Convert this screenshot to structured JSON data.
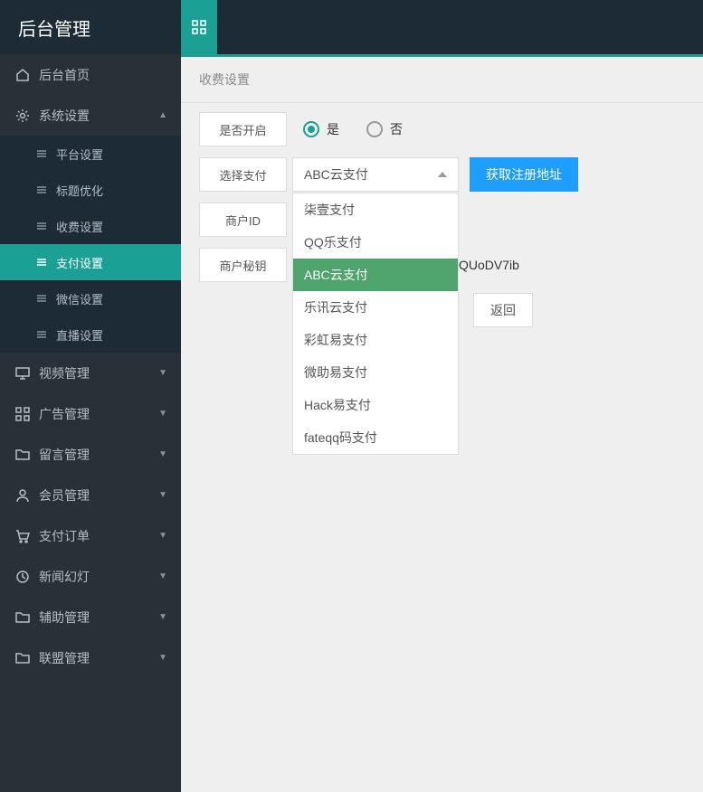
{
  "header": {
    "title": "后台管理"
  },
  "sidebar": {
    "items": [
      {
        "label": "后台首页",
        "icon": "home",
        "expandable": false
      },
      {
        "label": "系统设置",
        "icon": "gear",
        "expandable": true,
        "expanded": true,
        "children": [
          {
            "label": "平台设置"
          },
          {
            "label": "标题优化"
          },
          {
            "label": "收费设置"
          },
          {
            "label": "支付设置",
            "active": true
          },
          {
            "label": "微信设置"
          },
          {
            "label": "直播设置"
          }
        ]
      },
      {
        "label": "视频管理",
        "icon": "monitor",
        "expandable": true
      },
      {
        "label": "广告管理",
        "icon": "grid",
        "expandable": true
      },
      {
        "label": "留言管理",
        "icon": "folder",
        "expandable": true
      },
      {
        "label": "会员管理",
        "icon": "user",
        "expandable": true
      },
      {
        "label": "支付订单",
        "icon": "cart",
        "expandable": true
      },
      {
        "label": "新闻幻灯",
        "icon": "clock",
        "expandable": true
      },
      {
        "label": "辅助管理",
        "icon": "folder",
        "expandable": true
      },
      {
        "label": "联盟管理",
        "icon": "folder",
        "expandable": true
      }
    ]
  },
  "main": {
    "page_title": "收费设置",
    "form": {
      "enable_label": "是否开启",
      "enable_options": {
        "yes": "是",
        "no": "否"
      },
      "enable_value": "yes",
      "payment_label": "选择支付",
      "payment_selected": "ABC云支付",
      "payment_options": [
        "柒壹支付",
        "QQ乐支付",
        "ABC云支付",
        "乐讯云支付",
        "彩虹易支付",
        "微助易支付",
        "Hack易支付",
        "fateqq码支付"
      ],
      "register_button": "获取注册地址",
      "merchant_id_label": "商户ID",
      "merchant_key_label": "商户秘钥",
      "merchant_key_value": "QUoDV7ib",
      "back_button": "返回"
    }
  }
}
